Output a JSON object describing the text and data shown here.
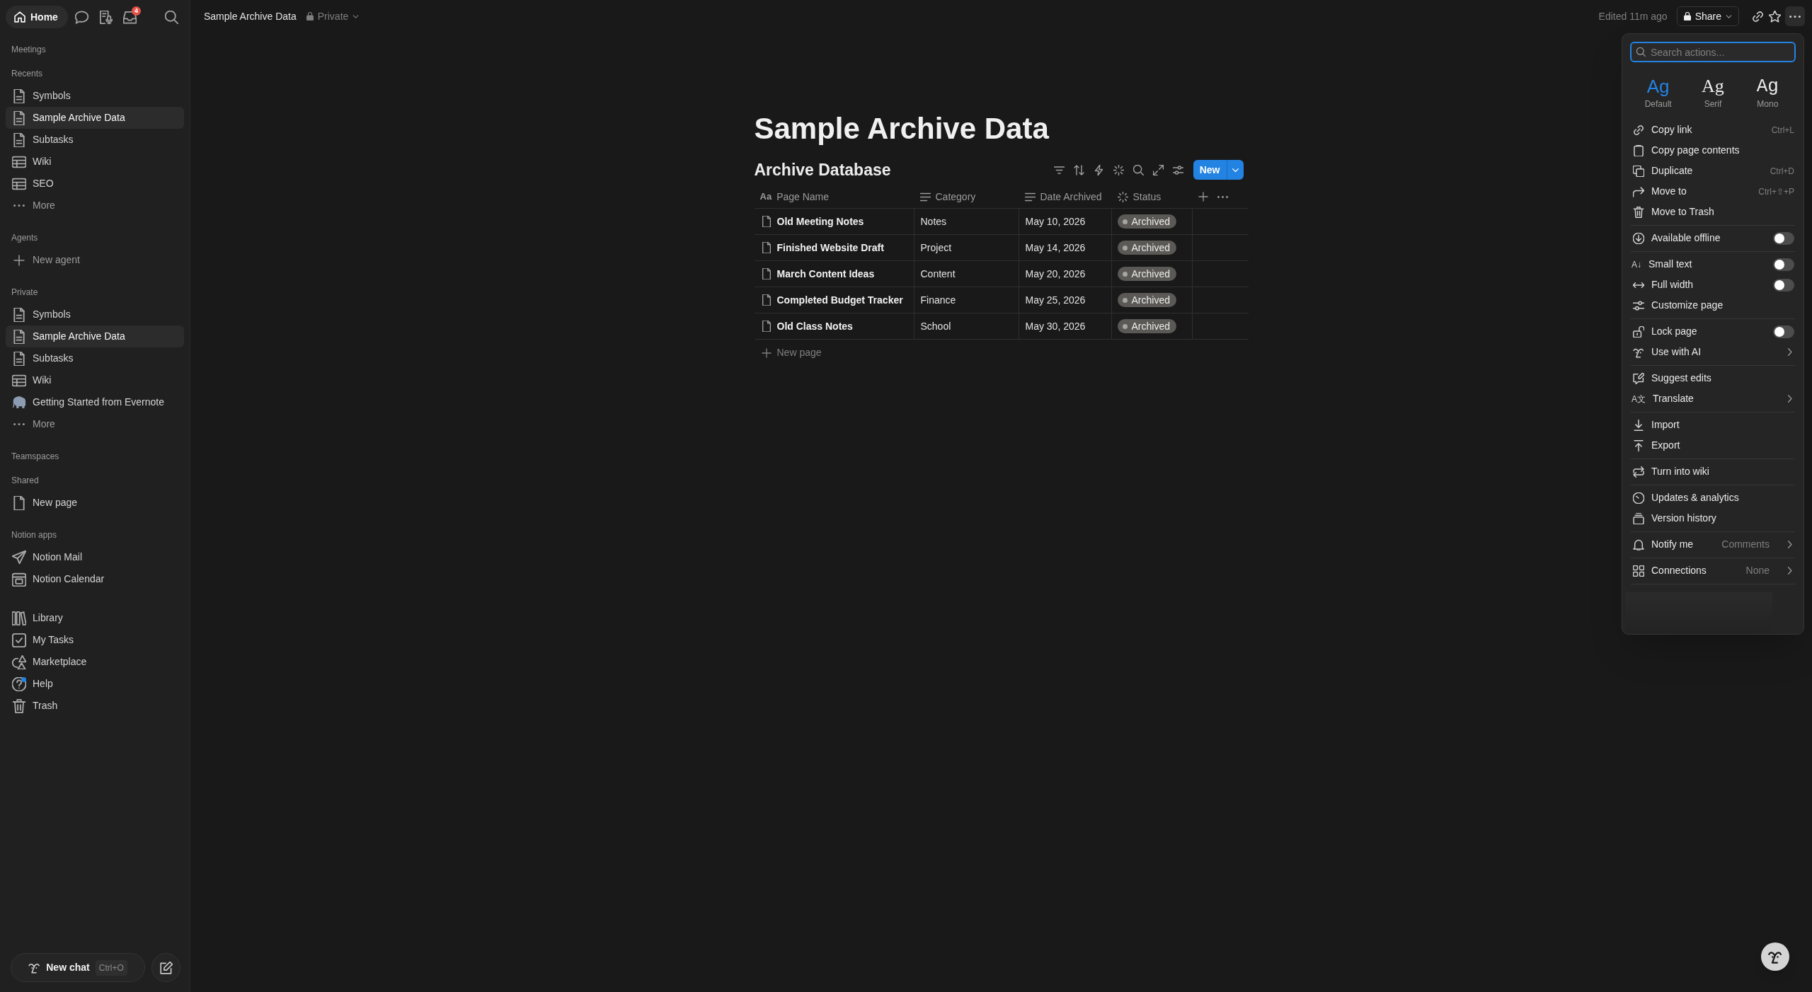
{
  "sidebar": {
    "home": "Home",
    "inbox_badge": "4",
    "sections": [
      {
        "title": "Meetings"
      },
      {
        "title": "Recents",
        "items": [
          {
            "label": "Symbols",
            "kind": "page",
            "selected": false
          },
          {
            "label": "Sample Archive Data",
            "kind": "page",
            "selected": true
          },
          {
            "label": "Subtasks",
            "kind": "page",
            "selected": false
          },
          {
            "label": "Wiki",
            "kind": "database",
            "selected": false
          },
          {
            "label": "SEO",
            "kind": "database",
            "selected": false
          },
          {
            "label": "More",
            "kind": "more",
            "selected": false
          }
        ]
      },
      {
        "title": "Agents",
        "items": [
          {
            "label": "New agent",
            "kind": "add",
            "selected": false
          }
        ]
      },
      {
        "title": "Private",
        "items": [
          {
            "label": "Symbols",
            "kind": "page",
            "selected": false
          },
          {
            "label": "Sample Archive Data",
            "kind": "page",
            "selected": true
          },
          {
            "label": "Subtasks",
            "kind": "page",
            "selected": false
          },
          {
            "label": "Wiki",
            "kind": "database",
            "selected": false
          },
          {
            "label": "Getting Started from Evernote",
            "kind": "imported",
            "selected": false
          },
          {
            "label": "More",
            "kind": "more",
            "selected": false
          }
        ]
      },
      {
        "title": "Teamspaces"
      },
      {
        "title": "Shared",
        "items": [
          {
            "label": "New page",
            "kind": "empty_page",
            "selected": false
          }
        ]
      },
      {
        "title": "Notion apps",
        "items": [
          {
            "label": "Notion Mail",
            "kind": "mail",
            "selected": false
          },
          {
            "label": "Notion Calendar",
            "kind": "calendar",
            "selected": false
          }
        ]
      },
      {
        "items": [
          {
            "label": "Library",
            "kind": "library",
            "selected": false,
            "notification": false
          },
          {
            "label": "My Tasks",
            "kind": "tasks",
            "selected": false,
            "notification": false
          },
          {
            "label": "Marketplace",
            "kind": "marketplace",
            "selected": false,
            "notification": false
          },
          {
            "label": "Help",
            "kind": "help",
            "selected": false,
            "notification": true
          },
          {
            "label": "Trash",
            "kind": "trash",
            "selected": false,
            "notification": false
          }
        ]
      }
    ],
    "new_chat": {
      "label": "New chat",
      "shortcut": "Ctrl+O"
    }
  },
  "topbar": {
    "breadcrumb": "Sample Archive Data",
    "privacy": "Private",
    "edited": "Edited 11m ago",
    "share": "Share"
  },
  "page": {
    "title": "Sample Archive Data",
    "database": {
      "title": "Archive Database",
      "new_button": "New",
      "columns": [
        {
          "label": "Page Name",
          "kind": "title",
          "icon_text": "Aa"
        },
        {
          "label": "Category",
          "kind": "text"
        },
        {
          "label": "Date Archived",
          "kind": "text"
        },
        {
          "label": "Status",
          "kind": "status"
        }
      ],
      "rows": [
        {
          "cells": [
            "Old Meeting Notes",
            "Notes",
            "May 10, 2026",
            "Archived"
          ]
        },
        {
          "cells": [
            "Finished Website Draft",
            "Project",
            "May 14, 2026",
            "Archived"
          ]
        },
        {
          "cells": [
            "March Content Ideas",
            "Content",
            "May 20, 2026",
            "Archived"
          ]
        },
        {
          "cells": [
            "Completed Budget Tracker",
            "Finance",
            "May 25, 2026",
            "Archived"
          ]
        },
        {
          "cells": [
            "Old Class Notes",
            "School",
            "May 30, 2026",
            "Archived"
          ]
        }
      ],
      "new_row": "New page"
    }
  },
  "actions_menu": {
    "open": true,
    "search": {
      "placeholder": "Search actions..."
    },
    "fonts": [
      {
        "sample": "Ag",
        "label": "Default",
        "kind": "sans",
        "selected": true
      },
      {
        "sample": "Ag",
        "label": "Serif",
        "kind": "serif",
        "selected": false
      },
      {
        "sample": "Ag",
        "label": "Mono",
        "kind": "mono",
        "selected": false
      }
    ],
    "groups": [
      {
        "items": [
          {
            "label": "Copy link",
            "kind": "action",
            "shortcut": "Ctrl+L"
          },
          {
            "label": "Copy page contents",
            "kind": "action"
          },
          {
            "label": "Duplicate",
            "kind": "action",
            "shortcut": "Ctrl+D"
          },
          {
            "label": "Move to",
            "kind": "action",
            "shortcut": "Ctrl+⇧+P"
          },
          {
            "label": "Move to Trash",
            "kind": "action"
          }
        ]
      },
      {
        "items": [
          {
            "label": "Available offline",
            "kind": "toggle",
            "on": false
          }
        ]
      },
      {
        "items": [
          {
            "label": "Small text",
            "kind": "toggle",
            "on": false,
            "icon_text": "A↓"
          },
          {
            "label": "Full width",
            "kind": "toggle",
            "on": false
          },
          {
            "label": "Customize page",
            "kind": "action"
          }
        ]
      },
      {
        "items": [
          {
            "label": "Lock page",
            "kind": "toggle",
            "on": false
          },
          {
            "label": "Use with AI",
            "kind": "submenu"
          }
        ]
      },
      {
        "items": [
          {
            "label": "Suggest edits",
            "kind": "action"
          },
          {
            "label": "Translate",
            "kind": "submenu",
            "icon_text": "A文"
          }
        ]
      },
      {
        "items": [
          {
            "label": "Import",
            "kind": "action"
          },
          {
            "label": "Export",
            "kind": "action"
          }
        ]
      },
      {
        "items": [
          {
            "label": "Turn into wiki",
            "kind": "action"
          }
        ]
      },
      {
        "items": [
          {
            "label": "Updates & analytics",
            "kind": "action"
          },
          {
            "label": "Version history",
            "kind": "action"
          }
        ]
      },
      {
        "items": [
          {
            "label": "Notify me",
            "kind": "submenu",
            "value": "Comments"
          }
        ]
      },
      {
        "items": [
          {
            "label": "Connections",
            "kind": "submenu",
            "value": "None"
          }
        ]
      }
    ]
  }
}
